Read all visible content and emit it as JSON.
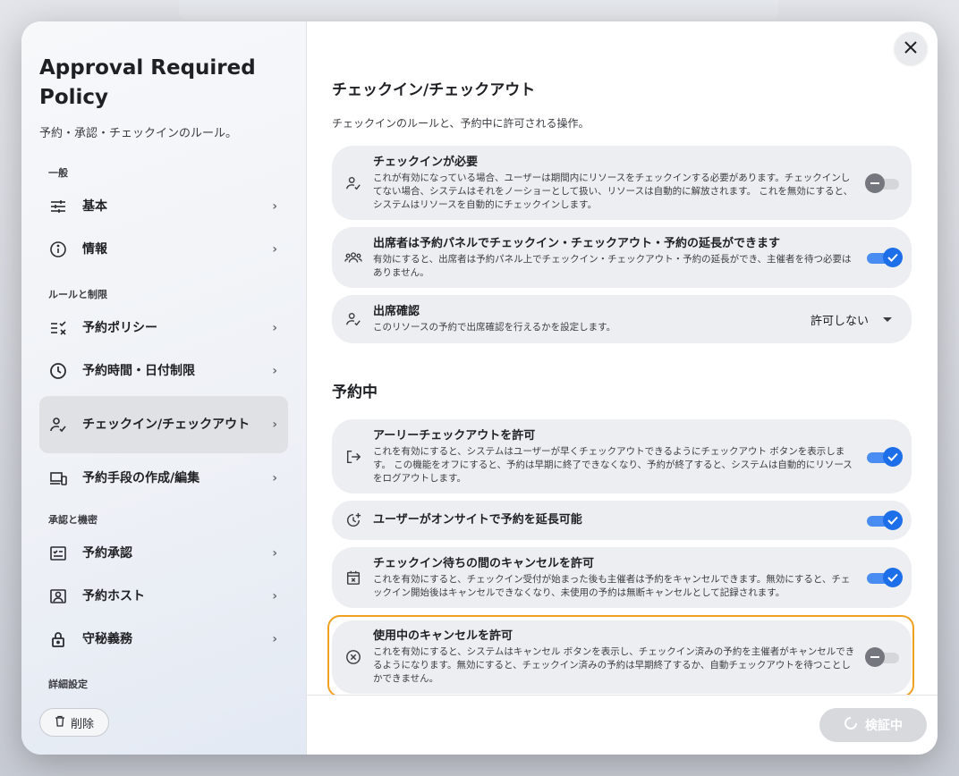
{
  "background": {
    "header_text": ""
  },
  "sidebar": {
    "title": "Approval Required Policy",
    "subtitle": "予約・承認・チェックインのルール。",
    "sections": [
      {
        "label": "一般",
        "items": [
          {
            "label": "基本",
            "icon": "sliders-icon"
          },
          {
            "label": "情報",
            "icon": "info-icon"
          }
        ]
      },
      {
        "label": "ルールと制限",
        "items": [
          {
            "label": "予約ポリシー",
            "icon": "rules-icon"
          },
          {
            "label": "予約時間・日付制限",
            "icon": "clock-icon"
          },
          {
            "label": "チェックイン/チェックアウト",
            "icon": "person-check-icon",
            "active": true
          },
          {
            "label": "予約手段の作成/編集",
            "icon": "devices-icon"
          }
        ]
      },
      {
        "label": "承認と機密",
        "items": [
          {
            "label": "予約承認",
            "icon": "checklist-icon"
          },
          {
            "label": "予約ホスト",
            "icon": "host-icon"
          },
          {
            "label": "守秘義務",
            "icon": "lock-icon"
          }
        ]
      },
      {
        "label": "詳細設定",
        "items": []
      }
    ],
    "delete_label": "削除"
  },
  "main": {
    "section1": {
      "heading": "チェックイン/チェックアウト",
      "description": "チェックインのルールと、予約中に許可される操作。",
      "cards": [
        {
          "title": "チェックインが必要",
          "description": "これが有効になっている場合、ユーザーは期間内にリソースをチェックインする必要があります。チェックインしてない場合、システムはそれをノーショーとして扱い、リソースは自動的に解放されます。 これを無効にすると、システムはリソースを自動的にチェックインします。",
          "icon": "person-check-icon",
          "control": "toggle",
          "on": false
        },
        {
          "title": "出席者は予約パネルでチェックイン・チェックアウト・予約の延長ができます",
          "description": "有効にすると、出席者は予約パネル上でチェックイン・チェックアウト・予約の延長ができ、主催者を待つ必要はありません。",
          "icon": "group-icon",
          "control": "toggle",
          "on": true
        },
        {
          "title": "出席確認",
          "description": "このリソースの予約で出席確認を行えるかを設定します。",
          "icon": "person-check-icon",
          "control": "select",
          "value": "許可しない"
        }
      ]
    },
    "section2": {
      "heading": "予約中",
      "cards": [
        {
          "title": "アーリーチェックアウトを許可",
          "description": "これを有効にすると、システムはユーザーが早くチェックアウトできるようにチェックアウト ボタンを表示します。 この機能をオフにすると、予約は早期に終了できなくなり、予約が終了すると、システムは自動的にリソースをログアウトします。",
          "icon": "logout-icon",
          "control": "toggle",
          "on": true
        },
        {
          "title": "ユーザーがオンサイトで予約を延長可能",
          "description": "",
          "icon": "extend-time-icon",
          "control": "toggle",
          "on": true
        },
        {
          "title": "チェックイン待ちの間のキャンセルを許可",
          "description": "これを有効にすると、チェックイン受付が始まった後も主催者は予約をキャンセルできます。無効にすると、チェックイン開始後はキャンセルできなくなり、未使用の予約は無断キャンセルとして記録されます。",
          "icon": "calendar-cancel-icon",
          "control": "toggle",
          "on": true
        },
        {
          "title": "使用中のキャンセルを許可",
          "description": "これを有効にすると、システムはキャンセル ボタンを表示し、チェックイン済みの予約を主催者がキャンセルできるようになります。無効にすると、チェックイン済みの予約は早期終了するか、自動チェックアウトを待つことしかできません。",
          "icon": "cancel-circle-icon",
          "control": "toggle",
          "on": false,
          "focused": true
        }
      ]
    },
    "footer": {
      "verify_label": "検証中"
    }
  },
  "colors": {
    "accent": "#1c6fe8",
    "focus": "#f0a020",
    "card_bg": "#edeef1"
  }
}
